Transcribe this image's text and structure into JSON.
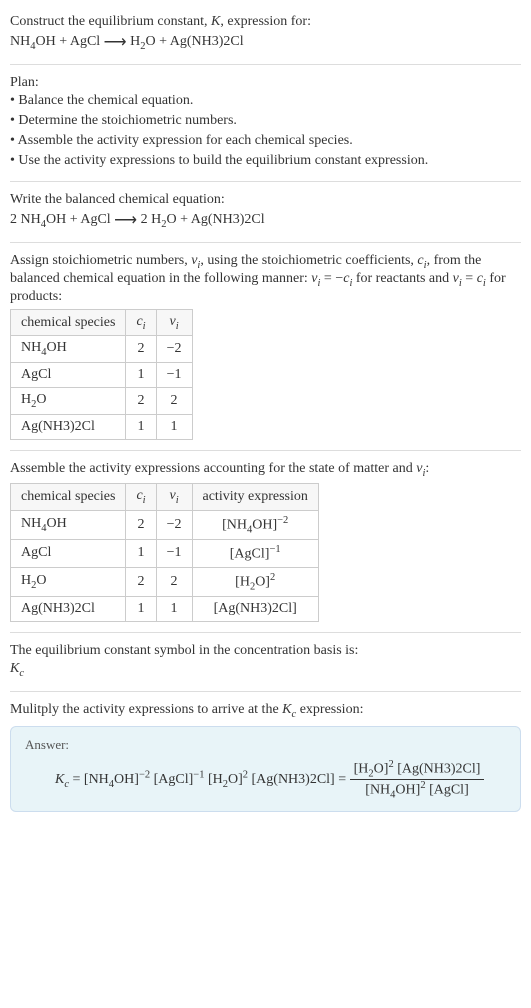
{
  "title": "Construct the equilibrium constant, K, expression for:",
  "unbalanced": "NH₄OH + AgCl ⟶ H₂O + Ag(NH3)2Cl",
  "plan_heading": "Plan:",
  "plan_items": [
    "Balance the chemical equation.",
    "Determine the stoichiometric numbers.",
    "Assemble the activity expression for each chemical species.",
    "Use the activity expressions to build the equilibrium constant expression."
  ],
  "balanced_heading": "Write the balanced chemical equation:",
  "balanced": "2 NH₄OH + AgCl ⟶ 2 H₂O + Ag(NH3)2Cl",
  "stoich_text": "Assign stoichiometric numbers, νᵢ, using the stoichiometric coefficients, cᵢ, from the balanced chemical equation in the following manner: νᵢ = −cᵢ for reactants and νᵢ = cᵢ for products:",
  "table1": {
    "headers": [
      "chemical species",
      "cᵢ",
      "νᵢ"
    ],
    "rows": [
      [
        "NH₄OH",
        "2",
        "−2"
      ],
      [
        "AgCl",
        "1",
        "−1"
      ],
      [
        "H₂O",
        "2",
        "2"
      ],
      [
        "Ag(NH3)2Cl",
        "1",
        "1"
      ]
    ]
  },
  "activity_text": "Assemble the activity expressions accounting for the state of matter and νᵢ:",
  "table2": {
    "headers": [
      "chemical species",
      "cᵢ",
      "νᵢ",
      "activity expression"
    ],
    "rows": [
      [
        "NH₄OH",
        "2",
        "−2",
        "[NH₄OH]⁻²"
      ],
      [
        "AgCl",
        "1",
        "−1",
        "[AgCl]⁻¹"
      ],
      [
        "H₂O",
        "2",
        "2",
        "[H₂O]²"
      ],
      [
        "Ag(NH3)2Cl",
        "1",
        "1",
        "[Ag(NH3)2Cl]"
      ]
    ]
  },
  "kc_symbol_text": "The equilibrium constant symbol in the concentration basis is:",
  "kc_symbol": "K_c",
  "multiply_text": "Mulitply the activity expressions to arrive at the K_c expression:",
  "answer_label": "Answer:",
  "answer_lhs": "K_c = [NH₄OH]⁻² [AgCl]⁻¹ [H₂O]² [Ag(NH3)2Cl] =",
  "answer_num": "[H₂O]² [Ag(NH3)2Cl]",
  "answer_den": "[NH₄OH]² [AgCl]"
}
